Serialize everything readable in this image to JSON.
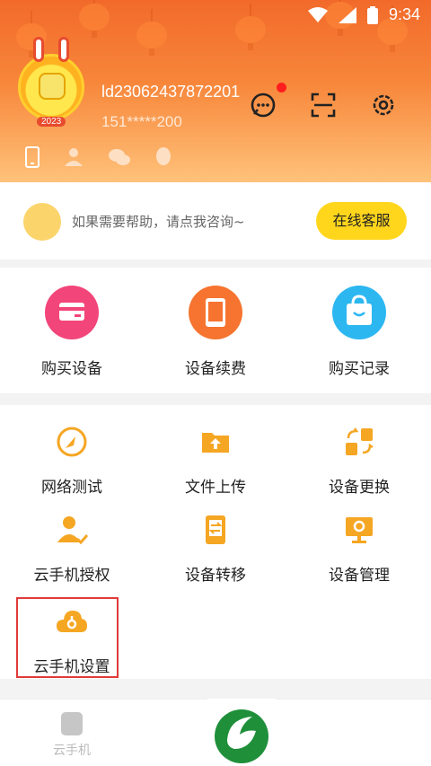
{
  "status": {
    "time": "9:34"
  },
  "user": {
    "id": "ld23062437872201",
    "phone": "151*****200",
    "avatar_year": "2023"
  },
  "help": {
    "text": "如果需要帮助，请点我咨询~",
    "button": "在线客服"
  },
  "purchase": [
    {
      "label": "购买设备",
      "icon": "card-icon",
      "color": "#f2457a"
    },
    {
      "label": "设备续费",
      "icon": "tablet-icon",
      "color": "#f6742f"
    },
    {
      "label": "购买记录",
      "icon": "shopping-bag-icon",
      "color": "#2cb7f1"
    }
  ],
  "tools": [
    {
      "label": "网络测试",
      "icon": "speedometer-icon"
    },
    {
      "label": "文件上传",
      "icon": "upload-icon"
    },
    {
      "label": "设备更换",
      "icon": "swap-icon"
    },
    {
      "label": "云手机授权",
      "icon": "user-authorize-icon"
    },
    {
      "label": "设备转移",
      "icon": "transfer-icon"
    },
    {
      "label": "设备管理",
      "icon": "monitor-gear-icon"
    },
    {
      "label": "云手机设置",
      "icon": "cloud-settings-icon"
    }
  ],
  "nav": [
    {
      "label": "云手机"
    }
  ],
  "colors": {
    "accent": "#ffd61c",
    "icon_orange": "#f5a623",
    "highlight": "#e03a3a"
  }
}
